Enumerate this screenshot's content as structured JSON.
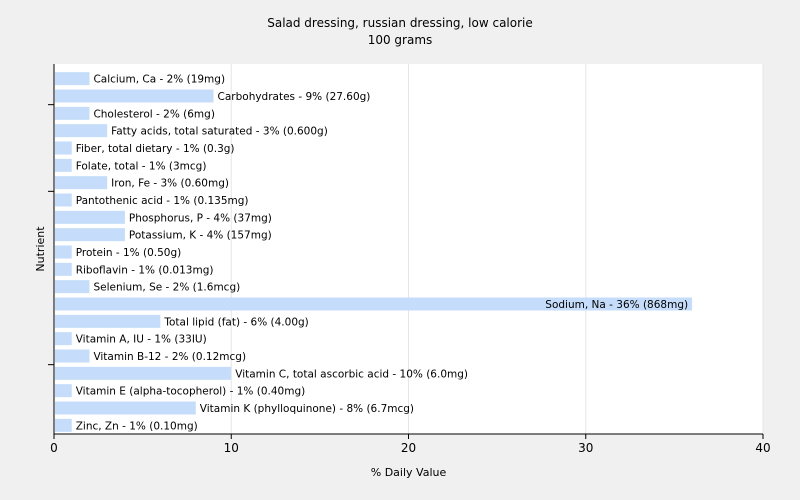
{
  "chart_data": {
    "type": "bar",
    "orientation": "horizontal",
    "title": "Salad dressing, russian dressing, low calorie",
    "subtitle": "100 grams",
    "xlabel": "% Daily Value",
    "ylabel": "Nutrient",
    "xlim": [
      0,
      40
    ],
    "xticks": [
      0,
      10,
      20,
      30,
      40
    ],
    "grid": true,
    "bar_color": "#c5dcfa",
    "categories": [
      "Calcium, Ca",
      "Carbohydrates",
      "Cholesterol",
      "Fatty acids, total saturated",
      "Fiber, total dietary",
      "Folate, total",
      "Iron, Fe",
      "Pantothenic acid",
      "Phosphorus, P",
      "Potassium, K",
      "Protein",
      "Riboflavin",
      "Selenium, Se",
      "Sodium, Na",
      "Total lipid (fat)",
      "Vitamin A, IU",
      "Vitamin B-12",
      "Vitamin C, total ascorbic acid",
      "Vitamin E (alpha-tocopherol)",
      "Vitamin K (phylloquinone)",
      "Zinc, Zn"
    ],
    "values": [
      2,
      9,
      2,
      3,
      1,
      1,
      3,
      1,
      4,
      4,
      1,
      1,
      2,
      36,
      6,
      1,
      2,
      10,
      1,
      8,
      1
    ],
    "labels": [
      "Calcium, Ca - 2% (19mg)",
      "Carbohydrates - 9% (27.60g)",
      "Cholesterol - 2% (6mg)",
      "Fatty acids, total saturated - 3% (0.600g)",
      "Fiber, total dietary - 1% (0.3g)",
      "Folate, total - 1% (3mcg)",
      "Iron, Fe - 3% (0.60mg)",
      "Pantothenic acid - 1% (0.135mg)",
      "Phosphorus, P - 4% (37mg)",
      "Potassium, K - 4% (157mg)",
      "Protein - 1% (0.50g)",
      "Riboflavin - 1% (0.013mg)",
      "Selenium, Se - 2% (1.6mcg)",
      "Sodium, Na - 36% (868mg)",
      "Total lipid (fat) - 6% (4.00g)",
      "Vitamin A, IU - 1% (33IU)",
      "Vitamin B-12 - 2% (0.12mcg)",
      "Vitamin C, total ascorbic acid - 10% (6.0mg)",
      "Vitamin E (alpha-tocopherol) - 1% (0.40mg)",
      "Vitamin K (phylloquinone) - 8% (6.7mcg)",
      "Zinc, Zn - 1% (0.10mg)"
    ]
  }
}
